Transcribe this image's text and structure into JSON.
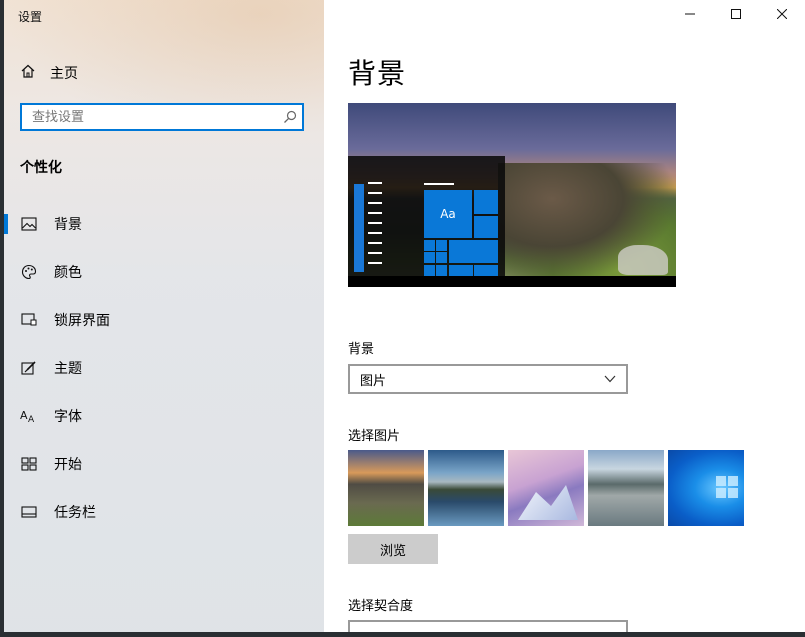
{
  "window": {
    "title": "设置"
  },
  "sidebar": {
    "home_label": "主页",
    "search_placeholder": "查找设置",
    "section_title": "个性化",
    "items": [
      {
        "label": "背景",
        "icon": "picture-icon",
        "active": true
      },
      {
        "label": "颜色",
        "icon": "palette-icon",
        "active": false
      },
      {
        "label": "锁屏界面",
        "icon": "lock-screen-icon",
        "active": false
      },
      {
        "label": "主题",
        "icon": "theme-brush-icon",
        "active": false
      },
      {
        "label": "字体",
        "icon": "font-icon",
        "active": false
      },
      {
        "label": "开始",
        "icon": "start-grid-icon",
        "active": false
      },
      {
        "label": "任务栏",
        "icon": "taskbar-icon",
        "active": false
      }
    ]
  },
  "main": {
    "page_title": "背景",
    "preview": {
      "tile_label": "Aa"
    },
    "background_label": "背景",
    "background_value": "图片",
    "choose_picture_label": "选择图片",
    "browse_label": "浏览",
    "fit_label": "选择契合度"
  },
  "colors": {
    "accent": "#0078d7"
  }
}
